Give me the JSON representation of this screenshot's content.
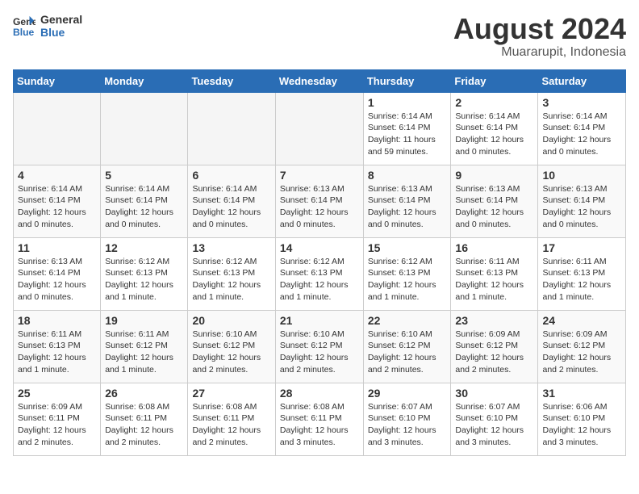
{
  "header": {
    "logo_line1": "General",
    "logo_line2": "Blue",
    "main_title": "August 2024",
    "subtitle": "Muararupit, Indonesia"
  },
  "weekdays": [
    "Sunday",
    "Monday",
    "Tuesday",
    "Wednesday",
    "Thursday",
    "Friday",
    "Saturday"
  ],
  "weeks": [
    [
      {
        "day": "",
        "empty": true
      },
      {
        "day": "",
        "empty": true
      },
      {
        "day": "",
        "empty": true
      },
      {
        "day": "",
        "empty": true
      },
      {
        "day": "1",
        "sunrise": "6:14 AM",
        "sunset": "6:14 PM",
        "daylight": "11 hours and 59 minutes."
      },
      {
        "day": "2",
        "sunrise": "6:14 AM",
        "sunset": "6:14 PM",
        "daylight": "12 hours and 0 minutes."
      },
      {
        "day": "3",
        "sunrise": "6:14 AM",
        "sunset": "6:14 PM",
        "daylight": "12 hours and 0 minutes."
      }
    ],
    [
      {
        "day": "4",
        "sunrise": "6:14 AM",
        "sunset": "6:14 PM",
        "daylight": "12 hours and 0 minutes."
      },
      {
        "day": "5",
        "sunrise": "6:14 AM",
        "sunset": "6:14 PM",
        "daylight": "12 hours and 0 minutes."
      },
      {
        "day": "6",
        "sunrise": "6:14 AM",
        "sunset": "6:14 PM",
        "daylight": "12 hours and 0 minutes."
      },
      {
        "day": "7",
        "sunrise": "6:13 AM",
        "sunset": "6:14 PM",
        "daylight": "12 hours and 0 minutes."
      },
      {
        "day": "8",
        "sunrise": "6:13 AM",
        "sunset": "6:14 PM",
        "daylight": "12 hours and 0 minutes."
      },
      {
        "day": "9",
        "sunrise": "6:13 AM",
        "sunset": "6:14 PM",
        "daylight": "12 hours and 0 minutes."
      },
      {
        "day": "10",
        "sunrise": "6:13 AM",
        "sunset": "6:14 PM",
        "daylight": "12 hours and 0 minutes."
      }
    ],
    [
      {
        "day": "11",
        "sunrise": "6:13 AM",
        "sunset": "6:14 PM",
        "daylight": "12 hours and 0 minutes."
      },
      {
        "day": "12",
        "sunrise": "6:12 AM",
        "sunset": "6:13 PM",
        "daylight": "12 hours and 1 minute."
      },
      {
        "day": "13",
        "sunrise": "6:12 AM",
        "sunset": "6:13 PM",
        "daylight": "12 hours and 1 minute."
      },
      {
        "day": "14",
        "sunrise": "6:12 AM",
        "sunset": "6:13 PM",
        "daylight": "12 hours and 1 minute."
      },
      {
        "day": "15",
        "sunrise": "6:12 AM",
        "sunset": "6:13 PM",
        "daylight": "12 hours and 1 minute."
      },
      {
        "day": "16",
        "sunrise": "6:11 AM",
        "sunset": "6:13 PM",
        "daylight": "12 hours and 1 minute."
      },
      {
        "day": "17",
        "sunrise": "6:11 AM",
        "sunset": "6:13 PM",
        "daylight": "12 hours and 1 minute."
      }
    ],
    [
      {
        "day": "18",
        "sunrise": "6:11 AM",
        "sunset": "6:13 PM",
        "daylight": "12 hours and 1 minute."
      },
      {
        "day": "19",
        "sunrise": "6:11 AM",
        "sunset": "6:12 PM",
        "daylight": "12 hours and 1 minute."
      },
      {
        "day": "20",
        "sunrise": "6:10 AM",
        "sunset": "6:12 PM",
        "daylight": "12 hours and 2 minutes."
      },
      {
        "day": "21",
        "sunrise": "6:10 AM",
        "sunset": "6:12 PM",
        "daylight": "12 hours and 2 minutes."
      },
      {
        "day": "22",
        "sunrise": "6:10 AM",
        "sunset": "6:12 PM",
        "daylight": "12 hours and 2 minutes."
      },
      {
        "day": "23",
        "sunrise": "6:09 AM",
        "sunset": "6:12 PM",
        "daylight": "12 hours and 2 minutes."
      },
      {
        "day": "24",
        "sunrise": "6:09 AM",
        "sunset": "6:12 PM",
        "daylight": "12 hours and 2 minutes."
      }
    ],
    [
      {
        "day": "25",
        "sunrise": "6:09 AM",
        "sunset": "6:11 PM",
        "daylight": "12 hours and 2 minutes."
      },
      {
        "day": "26",
        "sunrise": "6:08 AM",
        "sunset": "6:11 PM",
        "daylight": "12 hours and 2 minutes."
      },
      {
        "day": "27",
        "sunrise": "6:08 AM",
        "sunset": "6:11 PM",
        "daylight": "12 hours and 2 minutes."
      },
      {
        "day": "28",
        "sunrise": "6:08 AM",
        "sunset": "6:11 PM",
        "daylight": "12 hours and 3 minutes."
      },
      {
        "day": "29",
        "sunrise": "6:07 AM",
        "sunset": "6:10 PM",
        "daylight": "12 hours and 3 minutes."
      },
      {
        "day": "30",
        "sunrise": "6:07 AM",
        "sunset": "6:10 PM",
        "daylight": "12 hours and 3 minutes."
      },
      {
        "day": "31",
        "sunrise": "6:06 AM",
        "sunset": "6:10 PM",
        "daylight": "12 hours and 3 minutes."
      }
    ]
  ]
}
